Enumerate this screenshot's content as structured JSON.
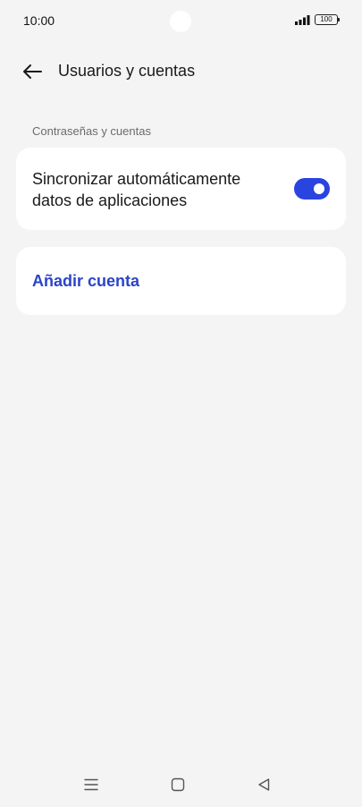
{
  "status_bar": {
    "time": "10:00",
    "battery": "100",
    "icons": [
      "signal-icon",
      "battery-icon"
    ]
  },
  "header": {
    "back_icon": "arrow-left-icon",
    "title": "Usuarios y cuentas"
  },
  "section": {
    "label": "Contraseñas y cuentas"
  },
  "sync_setting": {
    "label": "Sincronizar automáticamente datos de aplicaciones",
    "enabled": true,
    "accent": "#2a44e0"
  },
  "add_account": {
    "label": "Añadir cuenta",
    "color": "#2a44c8"
  },
  "nav_bar": {
    "icons": [
      "menu-icon",
      "home-square-icon",
      "back-triangle-icon"
    ]
  }
}
